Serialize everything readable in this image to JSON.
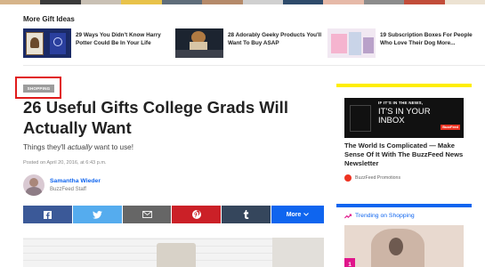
{
  "colors": {
    "accent_blue": "#0f65ef",
    "highlight_red": "#e01b1b",
    "ad_border_yellow": "#ffee00",
    "trending_pink": "#e0158b",
    "facebook": "#3b5998",
    "twitter": "#55acee",
    "email": "#666666",
    "pinterest": "#cb2027",
    "tumblr": "#35465c",
    "more": "#0f65ef"
  },
  "more_gift_ideas": {
    "heading": "More Gift Ideas",
    "items": [
      {
        "title": "29 Ways You Didn't Know Harry Potter Could Be In Your Life",
        "thumb": "harry-potter-thumb"
      },
      {
        "title": "28 Adorably Geeky Products You'll Want To Buy ASAP",
        "thumb": "geeky-products-thumb"
      },
      {
        "title": "19 Subscription Boxes For People Who Love Their Dog More...",
        "thumb": "dog-boxes-thumb"
      }
    ]
  },
  "article": {
    "category": "SHOPPING",
    "title": "26 Useful Gifts College Grads Will Actually Want",
    "subtitle_before": "Things they'll ",
    "subtitle_em": "actually",
    "subtitle_after": " want to use!",
    "posted": "Posted on April 20, 2016, at 6:43 p.m.",
    "author": {
      "name": "Samantha Wieder",
      "role": "BuzzFeed Staff"
    }
  },
  "share": {
    "buttons": [
      {
        "name": "facebook-share-button",
        "icon": "facebook-icon"
      },
      {
        "name": "twitter-share-button",
        "icon": "twitter-icon"
      },
      {
        "name": "email-share-button",
        "icon": "email-icon"
      },
      {
        "name": "pinterest-share-button",
        "icon": "pinterest-icon"
      },
      {
        "name": "tumblr-share-button",
        "icon": "tumblr-icon"
      }
    ],
    "more_label": "More"
  },
  "sidebar": {
    "ad": {
      "image_line1": "IF IT'S IN THE NEWS,",
      "image_line2": "IT'S IN YOUR INBOX",
      "image_badge": "BuzzFeed",
      "title": "The World Is Complicated — Make Sense Of It With The BuzzFeed News Newsletter",
      "sponsor": "BuzzFeed Promotions"
    },
    "trending": {
      "heading": "Trending on Shopping",
      "first_rank": "1"
    }
  }
}
